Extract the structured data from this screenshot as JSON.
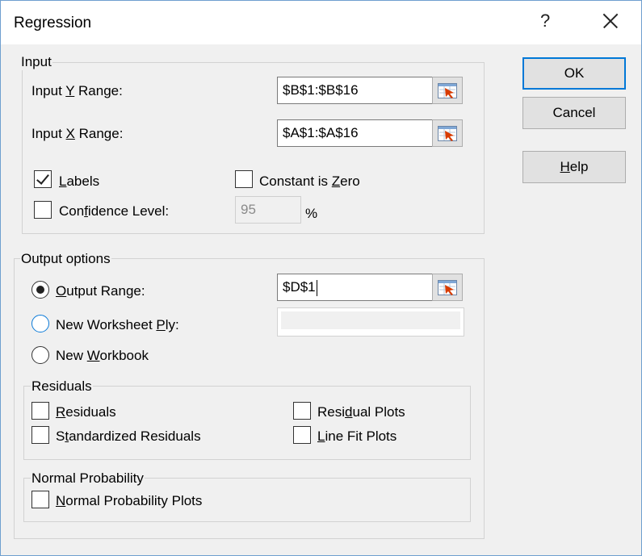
{
  "dialog": {
    "title": "Regression",
    "help_glyph": "?"
  },
  "input": {
    "group_label": "Input",
    "y_range_label": [
      "Input ",
      "Y",
      " Range:"
    ],
    "y_range_value": "$B$1:$B$16",
    "x_range_label": [
      "Input ",
      "X",
      " Range:"
    ],
    "x_range_value": "$A$1:$A$16",
    "labels": {
      "label": [
        "",
        "L",
        "abels"
      ],
      "checked": true
    },
    "constant_zero": {
      "label": [
        "Constant is ",
        "Z",
        "ero"
      ],
      "checked": false
    },
    "confidence": {
      "label": [
        "Con",
        "f",
        "idence Level:"
      ],
      "checked": false,
      "value": "95",
      "unit": "%"
    }
  },
  "output": {
    "group_label": "Output options",
    "output_range": {
      "label": [
        "",
        "O",
        "utput Range:"
      ],
      "selected": true,
      "value": "$D$1"
    },
    "new_ply": {
      "label": [
        "New Worksheet ",
        "P",
        "ly:"
      ],
      "selected": false,
      "value": ""
    },
    "new_workbook": {
      "label": [
        "New ",
        "W",
        "orkbook"
      ],
      "selected": false
    }
  },
  "residuals": {
    "group_label": "Residuals",
    "residuals": {
      "label": [
        "",
        "R",
        "esiduals"
      ],
      "checked": false
    },
    "standardized": {
      "label": [
        "S",
        "t",
        "andardized Residuals"
      ],
      "checked": false
    },
    "residual_plots": {
      "label": [
        "Resi",
        "d",
        "ual Plots"
      ],
      "checked": false
    },
    "line_fit_plots": {
      "label": [
        "",
        "L",
        "ine Fit Plots"
      ],
      "checked": false
    }
  },
  "normal": {
    "group_label": "Normal Probability",
    "plots": {
      "label": [
        "",
        "N",
        "ormal Probability Plots"
      ],
      "checked": false
    }
  },
  "buttons": {
    "ok": "OK",
    "cancel": "Cancel",
    "help": [
      "",
      "H",
      "elp"
    ]
  },
  "icons": {
    "close": "close-icon",
    "collapse_dialog": "collapse-dialog-icon"
  },
  "colors": {
    "accent": "#0078d7",
    "dialog_bg": "#f0f0f0",
    "title_bg": "#ffffff",
    "icon_red": "#d83b01"
  }
}
